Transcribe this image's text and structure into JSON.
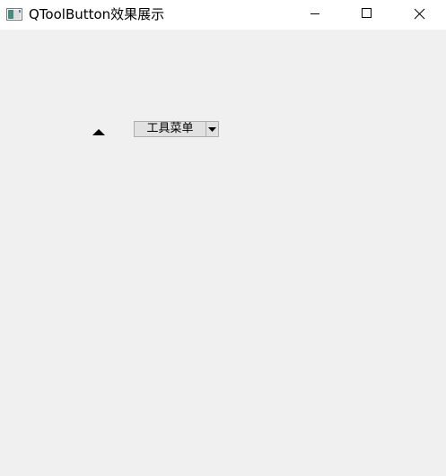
{
  "window": {
    "title": "QToolButton效果展示",
    "icon": "qt-app-icon",
    "controls": {
      "minimize_icon": "minimize-icon",
      "maximize_icon": "maximize-icon",
      "close_icon": "close-icon"
    }
  },
  "content": {
    "arrow_button": {
      "icon": "up-arrow-icon"
    },
    "menu_tool_button": {
      "label": "工具菜单",
      "menu_indicator_icon": "chevron-down-icon"
    }
  },
  "colors": {
    "titlebar_background": "#ffffff",
    "client_background": "#f0f0f0",
    "button_face": "#e1e1e1",
    "button_border": "#adadad"
  }
}
